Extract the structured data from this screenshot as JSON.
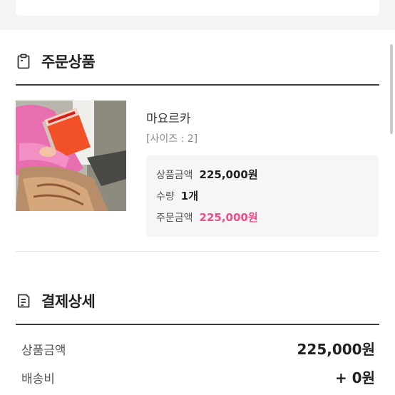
{
  "order_items": {
    "title": "주문상품",
    "icon": "clipboard-icon",
    "product": {
      "name": "마요르카",
      "option": "[사이즈 : 2]",
      "price_label": "상품금액",
      "price_value": "225,000원",
      "quantity_label": "수량",
      "quantity_value": "1개",
      "order_total_label": "주문금액",
      "order_total_value": "225,000원"
    }
  },
  "payment_details": {
    "title": "결제상세",
    "icon": "receipt-icon",
    "rows": [
      {
        "label": "상품금액",
        "value": "225,000원"
      },
      {
        "label": "배송비",
        "value": "+ 0원"
      }
    ]
  },
  "colors": {
    "accent_pink": "#ec4d8a",
    "text_dark": "#222222"
  }
}
